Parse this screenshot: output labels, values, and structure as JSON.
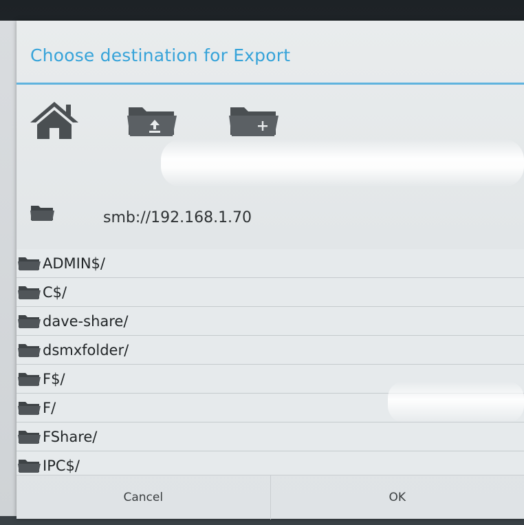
{
  "dialog": {
    "title": "Choose destination for Export",
    "accent_color": "#36a3d9"
  },
  "toolbar": {
    "buttons": [
      {
        "icon": "home-icon"
      },
      {
        "icon": "folder-up-icon"
      },
      {
        "icon": "new-folder-icon"
      }
    ]
  },
  "path": {
    "icon": "folder-icon",
    "value": "smb://192.168.1.70"
  },
  "folders": [
    "ADMIN$/",
    "C$/",
    "dave-share/",
    "dsmxfolder/",
    "F$/",
    "F/",
    "FShare/",
    "IPC$/"
  ],
  "actions": {
    "cancel_label": "Cancel",
    "ok_label": "OK"
  }
}
